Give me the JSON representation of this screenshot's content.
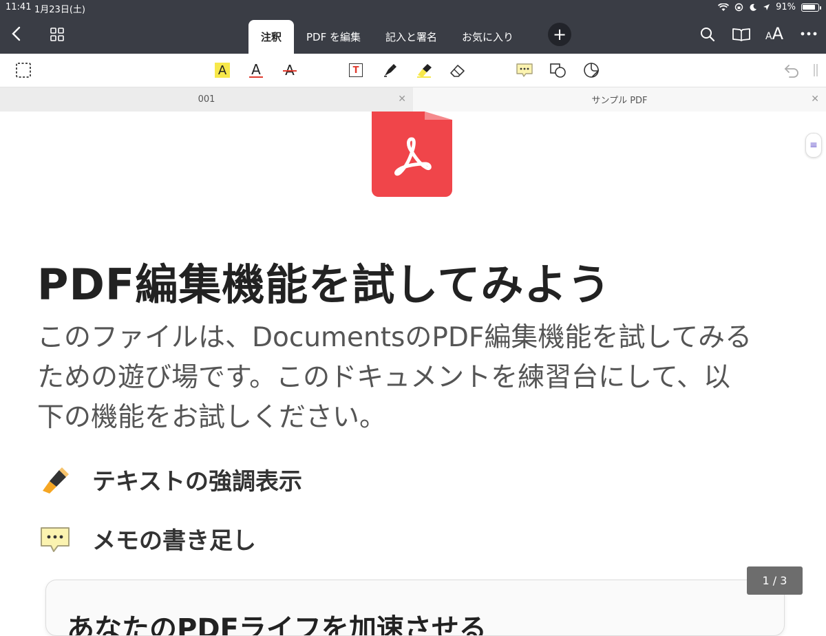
{
  "status": {
    "time": "11:41",
    "date": "1月23日(土)",
    "battery": "91%",
    "battery_level": 0.91
  },
  "nav": {
    "tabs": [
      "注釈",
      "PDF を編集",
      "記入と署名",
      "お気に入り"
    ],
    "active_tab": "注釈",
    "text_size_icon": "AA"
  },
  "doc_tabs": [
    {
      "label": "001"
    },
    {
      "label": "サンプル PDF"
    }
  ],
  "toolbar": {
    "highlight_letter": "A",
    "underline_letter": "A",
    "strike_letter": "A",
    "textbox_letter": "T"
  },
  "document": {
    "title": "PDF編集機能を試してみよう",
    "intro_lines": [
      "このファイルは、DocumentsのPDF編集機能を試してみる",
      "ための遊び場です。このドキュメントを練習台にして、以",
      "下の機能をお試しください。"
    ],
    "features": [
      {
        "label": "テキストの強調表示",
        "icon": "highlighter-icon"
      },
      {
        "label": "メモの書き足し",
        "icon": "note-icon"
      }
    ],
    "card_title": "あなたのPDFライフを加速させる"
  },
  "page_indicator": "1 / 3",
  "colors": {
    "topbar": "#3a3d45",
    "pdf_red": "#f0454a",
    "highlight_yellow": "#f7e84a",
    "annotation_red": "#e03a2e",
    "note_yellow": "#fbf3b0"
  }
}
